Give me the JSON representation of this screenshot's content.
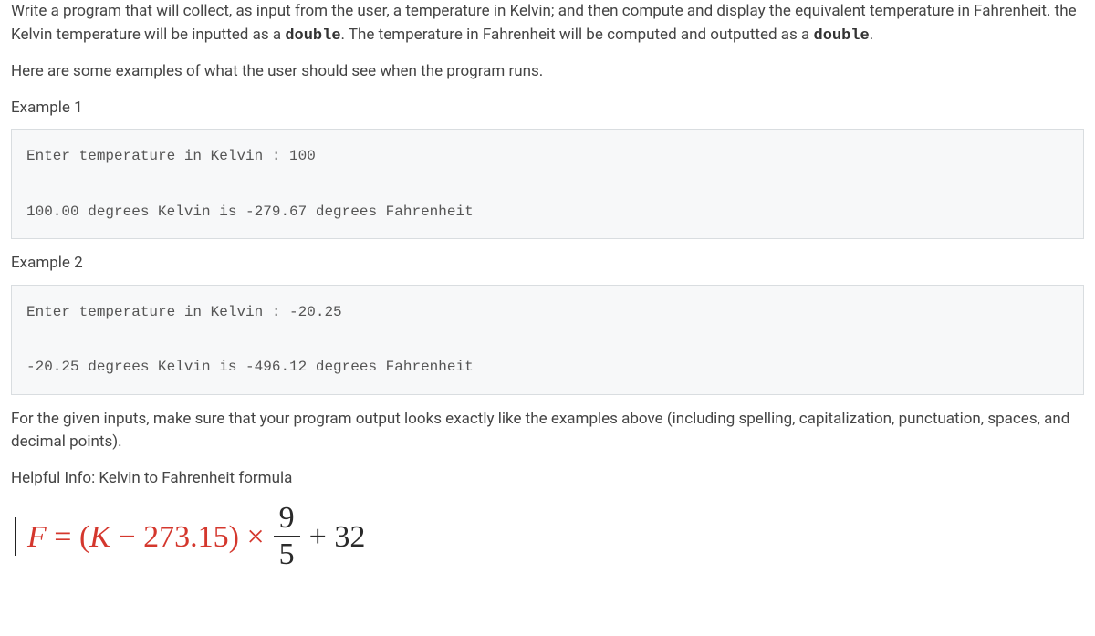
{
  "intro": {
    "p1_part1": "Write a program that will collect, as input from the user, a temperature in Kelvin; and then compute and display the equivalent temperature in Fahrenheit. the Kelvin temperature will be inputted as a ",
    "p1_code1": "double",
    "p1_part2": ". The temperature in Fahrenheit will be computed and outputted as a ",
    "p1_code2": "double",
    "p1_part3": "."
  },
  "examples_intro": "Here are some examples of what the user should see when the program runs.",
  "example1": {
    "label": "Example 1",
    "code": "Enter temperature in Kelvin : 100\n\n100.00 degrees Kelvin is -279.67 degrees Fahrenheit"
  },
  "example2": {
    "label": "Example 2",
    "code": "Enter temperature in Kelvin : -20.25\n\n-20.25 degrees Kelvin is -496.12 degrees Fahrenheit"
  },
  "followup": "For the given inputs, make sure that your program output looks exactly like the examples above (including spelling, capitalization, punctuation, spaces, and decimal points).",
  "helpful_label": "Helpful Info:",
  "helpful_text": " Kelvin to Fahrenheit formula",
  "formula": {
    "F": "F",
    "eq": " = (",
    "K": "K",
    "minus": " − 273.15) × ",
    "frac_num": "9",
    "frac_den": "5",
    "plus": " + 32"
  }
}
